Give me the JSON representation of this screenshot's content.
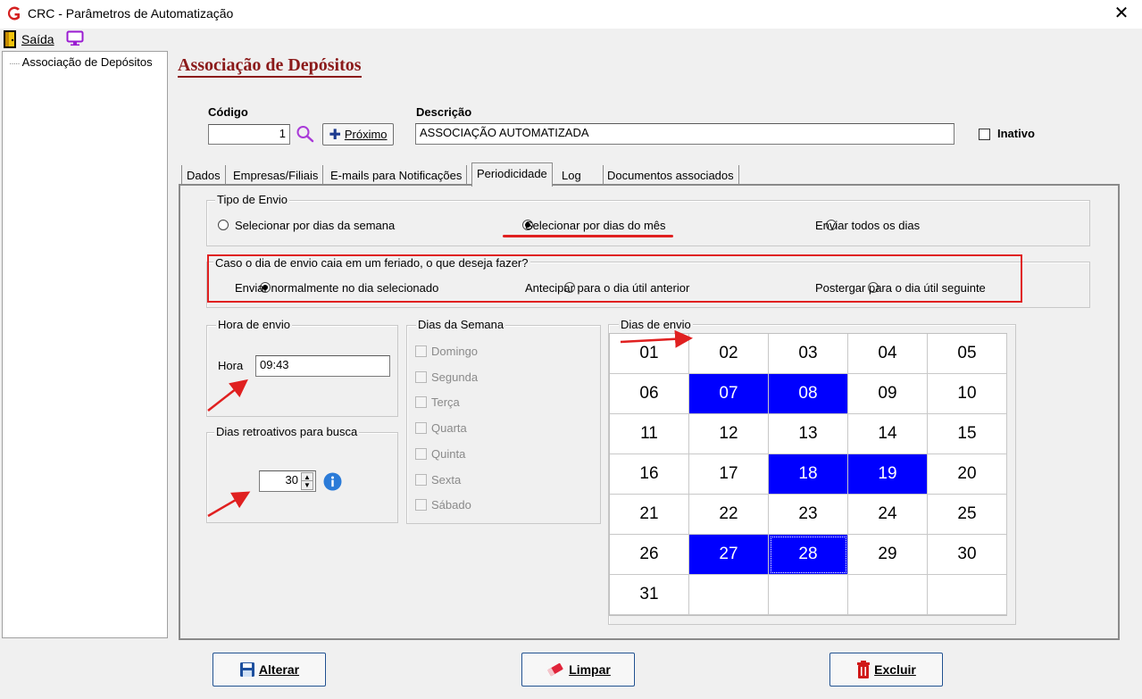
{
  "window": {
    "title": "CRC - Parâmetros de Automatização"
  },
  "menu": {
    "exit_label": "Saída"
  },
  "tree": {
    "items": [
      "Associação de Depósitos"
    ]
  },
  "page": {
    "title": "Associação de Depósitos"
  },
  "form": {
    "codigo_label": "Código",
    "codigo_value": "1",
    "proximo_label": "Próximo",
    "descricao_label": "Descrição",
    "descricao_value": "ASSOCIAÇÃO AUTOMATIZADA",
    "inativo_label": "Inativo",
    "inativo_checked": false
  },
  "tabs": [
    {
      "label": "Dados",
      "active": false
    },
    {
      "label": "Empresas/Filiais",
      "active": false
    },
    {
      "label": "E-mails para Notificações",
      "active": false
    },
    {
      "label": "Periodicidade",
      "active": true
    },
    {
      "label": "Log",
      "active": false
    },
    {
      "label": "Documentos associados",
      "active": false
    }
  ],
  "tipo_envio": {
    "title": "Tipo de Envio",
    "options": [
      {
        "label": "Selecionar por dias da semana",
        "selected": false
      },
      {
        "label": "Selecionar por dias do mês",
        "selected": true
      },
      {
        "label": "Enviar todos os dias",
        "selected": false
      }
    ]
  },
  "feriado": {
    "title": "Caso o dia de envio caia em um feriado, o que deseja fazer?",
    "options": [
      {
        "label": "Enviar normalmente no dia selecionado",
        "selected": true
      },
      {
        "label": "Antecipar para o dia útil anterior",
        "selected": false
      },
      {
        "label": "Postergar para o dia útil seguinte",
        "selected": false
      }
    ]
  },
  "hora_envio": {
    "title": "Hora de envio",
    "label": "Hora",
    "value": "09:43"
  },
  "dias_retroativos": {
    "title": "Dias retroativos para busca",
    "value": "30"
  },
  "dias_semana": {
    "title": "Dias da Semana",
    "days": [
      "Domingo",
      "Segunda",
      "Terça",
      "Quarta",
      "Quinta",
      "Sexta",
      "Sábado"
    ]
  },
  "dias_envio": {
    "title": "Dias de envio",
    "days": [
      "01",
      "02",
      "03",
      "04",
      "05",
      "06",
      "07",
      "08",
      "09",
      "10",
      "11",
      "12",
      "13",
      "14",
      "15",
      "16",
      "17",
      "18",
      "19",
      "20",
      "21",
      "22",
      "23",
      "24",
      "25",
      "26",
      "27",
      "28",
      "29",
      "30",
      "31"
    ],
    "selected": [
      "07",
      "08",
      "18",
      "19",
      "27",
      "28"
    ],
    "focused": "28"
  },
  "actions": {
    "alterar": "Alterar",
    "limpar": "Limpar",
    "excluir": "Excluir"
  },
  "colors": {
    "selected_day": "#0000ff",
    "title_red": "#8b1a1a",
    "highlight_red": "#e02020"
  }
}
